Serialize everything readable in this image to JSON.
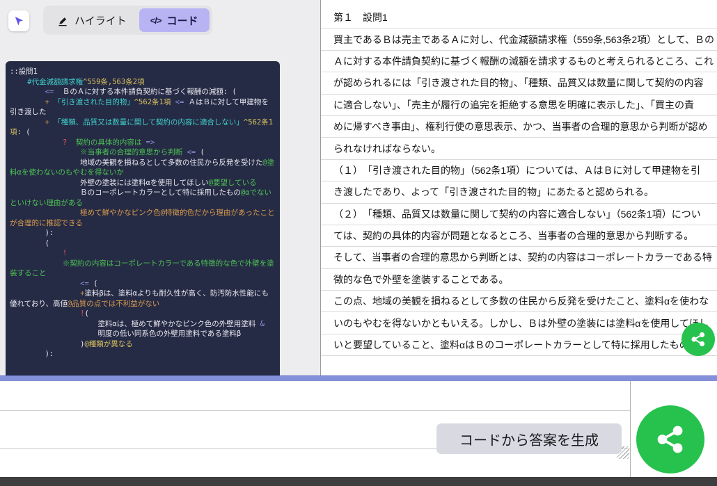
{
  "toolbar": {
    "highlight_label": "ハイライト",
    "code_label": "コード",
    "code_icon_glyph": "</>"
  },
  "editor": {
    "lines": [
      {
        "segments": [
          {
            "text": "::設問1",
            "color": "plain"
          }
        ]
      },
      {
        "segments": [
          {
            "text": "    ",
            "color": "plain"
          },
          {
            "text": "#代金減額請求権",
            "color": "cyan"
          },
          {
            "text": "^559条,563条2項",
            "color": "yellow"
          }
        ]
      },
      {
        "segments": [
          {
            "text": "        ",
            "color": "plain"
          },
          {
            "text": "<=",
            "color": "purple"
          },
          {
            "text": "  ＢのＡに対する本件請負契約に基づく報酬の減額: (",
            "color": "plain"
          }
        ]
      },
      {
        "segments": [
          {
            "text": "        ",
            "color": "plain"
          },
          {
            "text": "+ ",
            "color": "orange"
          },
          {
            "text": "「引き渡された目的物」",
            "color": "cyan"
          },
          {
            "text": "^562条1項",
            "color": "yellow"
          },
          {
            "text": " ",
            "color": "plain"
          },
          {
            "text": "<=",
            "color": "purple"
          },
          {
            "text": " ＡはＢに対して甲建物を引き渡した",
            "color": "plain"
          }
        ]
      },
      {
        "segments": [
          {
            "text": "        ",
            "color": "plain"
          },
          {
            "text": "+ ",
            "color": "orange"
          },
          {
            "text": "「種類、品質又は数量に関して契約の内容に適合しない」",
            "color": "cyan"
          },
          {
            "text": "^562条1項",
            "color": "yellow"
          },
          {
            "text": ": (",
            "color": "plain"
          }
        ]
      },
      {
        "segments": [
          {
            "text": "            ",
            "color": "plain"
          },
          {
            "text": "?",
            "color": "red"
          },
          {
            "text": "  ",
            "color": "plain"
          },
          {
            "text": "契約の具体的内容は ",
            "color": "green"
          },
          {
            "text": "=>",
            "color": "purple"
          }
        ]
      },
      {
        "segments": [
          {
            "text": "                ",
            "color": "plain"
          },
          {
            "text": "※当事者の合理的意思から判断",
            "color": "green"
          },
          {
            "text": " ",
            "color": "plain"
          },
          {
            "text": "<=",
            "color": "purple"
          },
          {
            "text": " (",
            "color": "plain"
          }
        ]
      },
      {
        "segments": [
          {
            "text": "                ",
            "color": "plain"
          },
          {
            "text": "地域の美観を損ねるとして多数の住民から反発を受けた",
            "color": "plain"
          },
          {
            "text": "@塗料αを使わないのもやむを得ないか",
            "color": "green"
          }
        ]
      },
      {
        "segments": [
          {
            "text": "                ",
            "color": "plain"
          },
          {
            "text": "外壁の塗装には塗料αを使用してほしい",
            "color": "plain"
          },
          {
            "text": "@要望している",
            "color": "green"
          }
        ]
      },
      {
        "segments": [
          {
            "text": "                ",
            "color": "plain"
          },
          {
            "text": "Ｂのコーポレートカラーとして特に採用したもの",
            "color": "plain"
          },
          {
            "text": "@αでないといけない理由がある",
            "color": "green"
          }
        ]
      },
      {
        "segments": [
          {
            "text": "                ",
            "color": "plain"
          },
          {
            "text": "極めて鮮やかなピンク色@特徴的色だから理由があったことが合理的に推認できる",
            "color": "orange"
          }
        ]
      },
      {
        "segments": [
          {
            "text": "        ):",
            "color": "plain"
          }
        ]
      },
      {
        "segments": [
          {
            "text": "        (",
            "color": "plain"
          }
        ]
      },
      {
        "segments": [
          {
            "text": "            ",
            "color": "plain"
          },
          {
            "text": "!",
            "color": "red"
          }
        ]
      },
      {
        "segments": [
          {
            "text": "            ",
            "color": "plain"
          },
          {
            "text": "※契約の内容はコーポレートカラーである特徴的な色で外壁を塗装すること",
            "color": "green"
          }
        ]
      },
      {
        "segments": [
          {
            "text": "                ",
            "color": "plain"
          },
          {
            "text": "<=",
            "color": "purple"
          },
          {
            "text": " (",
            "color": "plain"
          }
        ]
      },
      {
        "segments": [
          {
            "text": "                ",
            "color": "plain"
          },
          {
            "text": "+",
            "color": "orange"
          },
          {
            "text": "塗料βは、塗料αよりも耐久性が高く、防汚防水性能にも優れており、高値",
            "color": "plain"
          },
          {
            "text": "@品質の点では不利益がない",
            "color": "orange"
          }
        ]
      },
      {
        "segments": [
          {
            "text": "                ",
            "color": "plain"
          },
          {
            "text": "!",
            "color": "red"
          },
          {
            "text": "(",
            "color": "plain"
          }
        ]
      },
      {
        "segments": [
          {
            "text": "                    ",
            "color": "plain"
          },
          {
            "text": "塗料αは、極めて鮮やかなピンク色の外壁用塗料 ",
            "color": "plain"
          },
          {
            "text": "&",
            "color": "purple"
          }
        ]
      },
      {
        "segments": [
          {
            "text": "                    ",
            "color": "plain"
          },
          {
            "text": "明度の低い同系色の外壁用塗料である塗料β",
            "color": "plain"
          }
        ]
      },
      {
        "segments": [
          {
            "text": "                ",
            "color": "plain"
          },
          {
            "text": ")",
            "color": "plain"
          },
          {
            "text": "@種類が異なる",
            "color": "yellow"
          }
        ]
      },
      {
        "segments": [
          {
            "text": "        ):",
            "color": "plain"
          }
        ]
      }
    ]
  },
  "document": {
    "lines": [
      "第１　設問1",
      "買主であるＢは売主であるＡに対し、代金減額請求権（559条,563条2項）として、Ｂの",
      "Ａに対する本件請負契約に基づく報酬の減額を請求するものと考えられるところ、これ",
      "が認められるには「引き渡された目的物」、「種類、品質又は数量に関して契約の内容",
      "に適合しない」、「売主が履行の追完を拒絶する意思を明確に表示した」、「買主の責",
      "めに帰すべき事由」、権利行使の意思表示、かつ、当事者の合理的意思から判断が認め",
      "られなければならない。",
      "（１）　「引き渡された目的物」（562条1項）については、ＡはＢに対して甲建物を引",
      "き渡したであり、よって「引き渡された目的物」にあたると認められる。",
      "（２）　「種類、品質又は数量に関して契約の内容に適合しない」（562条1項）につい",
      "ては、契約の具体的内容が問題となるところ、当事者の合理的意思から判断する。",
      "そして、当事者の合理的意思から判断とは、契約の内容はコーポレートカラーである特",
      "徴的な色で外壁を塗装することである。",
      "この点、地域の美観を損ねるとして多数の住民から反発を受けたこと、塗料αを使わな",
      "いのもやむを得ないかともいえる。しかし、Ｂは外壁の塗装には塗料αを使用してほし",
      "いと要望していること、塗料αはＢのコーポレートカラーとして特に採用したものであ"
    ]
  },
  "footer": {
    "generate_tooltip": "コードから答案を生成"
  },
  "colors": {
    "accent_purple": "#B8B4F4",
    "divider_blue": "#8590DA",
    "fab_green": "#26C24D",
    "editor_background": "#262B45",
    "token_cyan": "#3FCFCA",
    "token_yellow": "#D6C05F",
    "token_green": "#4CC253",
    "token_orange": "#D99C4E",
    "token_red": "#E0565F",
    "token_purple": "#8A90D9"
  }
}
